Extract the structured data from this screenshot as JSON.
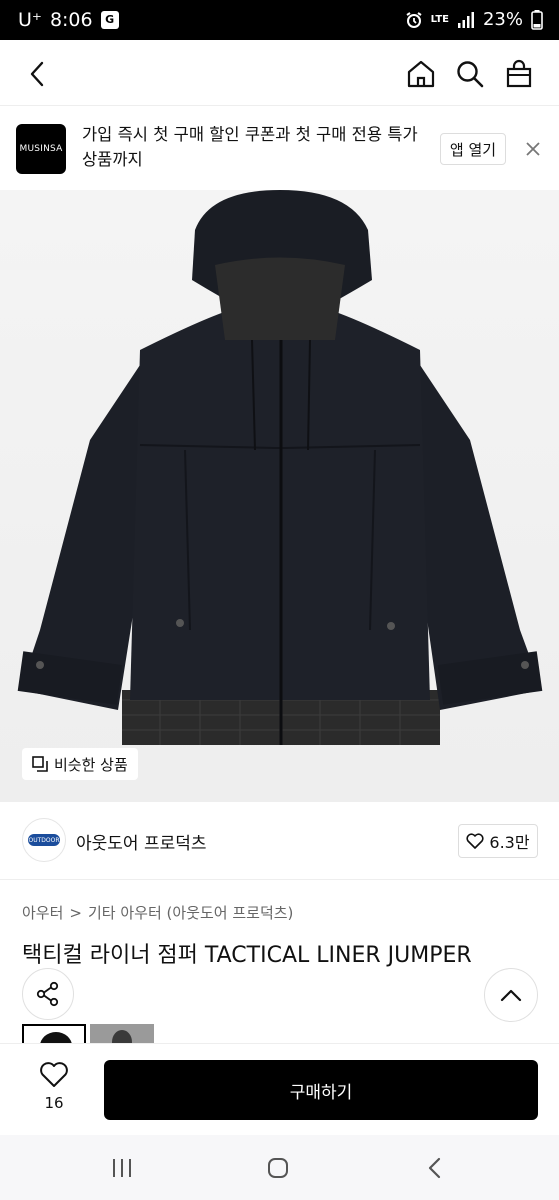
{
  "status_bar": {
    "carrier": "U⁺",
    "time": "8:06",
    "g_badge": "G",
    "network": "LTE",
    "battery": "23%"
  },
  "nav": {
    "back_icon": "chevron-left-icon",
    "home_icon": "home-icon",
    "search_icon": "search-icon",
    "cart_icon": "bag-icon"
  },
  "banner": {
    "logo_text": "MUSINSA",
    "message": "가입 즉시 첫 구매 할인 쿠폰과 첫 구매 전용 특가 상품까지",
    "open_app_label": "앱 열기"
  },
  "hero": {
    "similar_label": "비슷한 상품"
  },
  "brand": {
    "logo_text": "OUTDOOR",
    "name": "아웃도어 프로덕츠",
    "likes": "6.3만"
  },
  "breadcrumb": {
    "level1": "아우터",
    "separator": ">",
    "level2": "기타 아우터 (아웃도어 프로덕츠)"
  },
  "product": {
    "title": "택티컬 라이너 점퍼 TACTICAL LINER JUMPER"
  },
  "bottom_bar": {
    "wish_count": "16",
    "buy_label": "구매하기"
  },
  "colors": {
    "accent": "#000000",
    "brand_blue": "#1b4d9c"
  }
}
